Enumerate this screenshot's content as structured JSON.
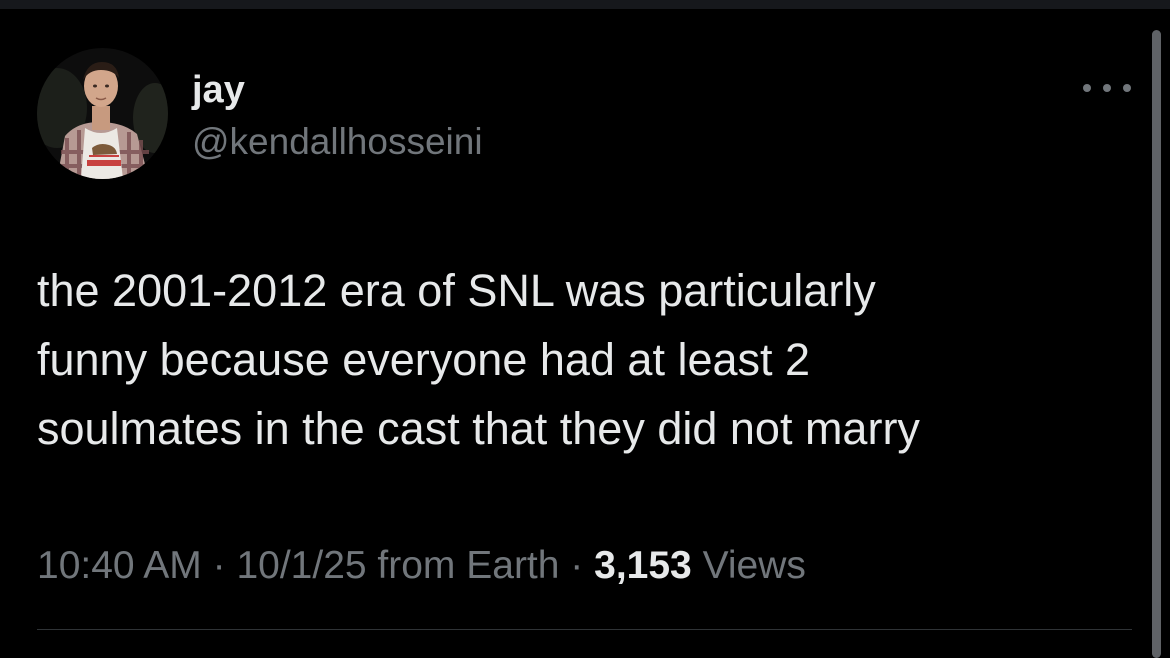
{
  "author": {
    "display_name": "jay",
    "handle": "@kendallhosseini",
    "avatar_icon": "profile-photo"
  },
  "tweet": {
    "text_lines": [
      "the 2001-2012 era of SNL was particularly",
      "funny because everyone had at least 2",
      "soulmates in the cast that they did not marry"
    ]
  },
  "meta": {
    "time": "10:40 AM",
    "separator": " · ",
    "date_source": "10/1/25 from Earth",
    "views_count": "3,153",
    "views_label": " Views"
  },
  "icons": {
    "more": "more-options-icon"
  },
  "colors": {
    "background": "#000000",
    "primary_text": "#e7e9ea",
    "secondary_text": "#71767b",
    "divider": "#2f3336"
  }
}
